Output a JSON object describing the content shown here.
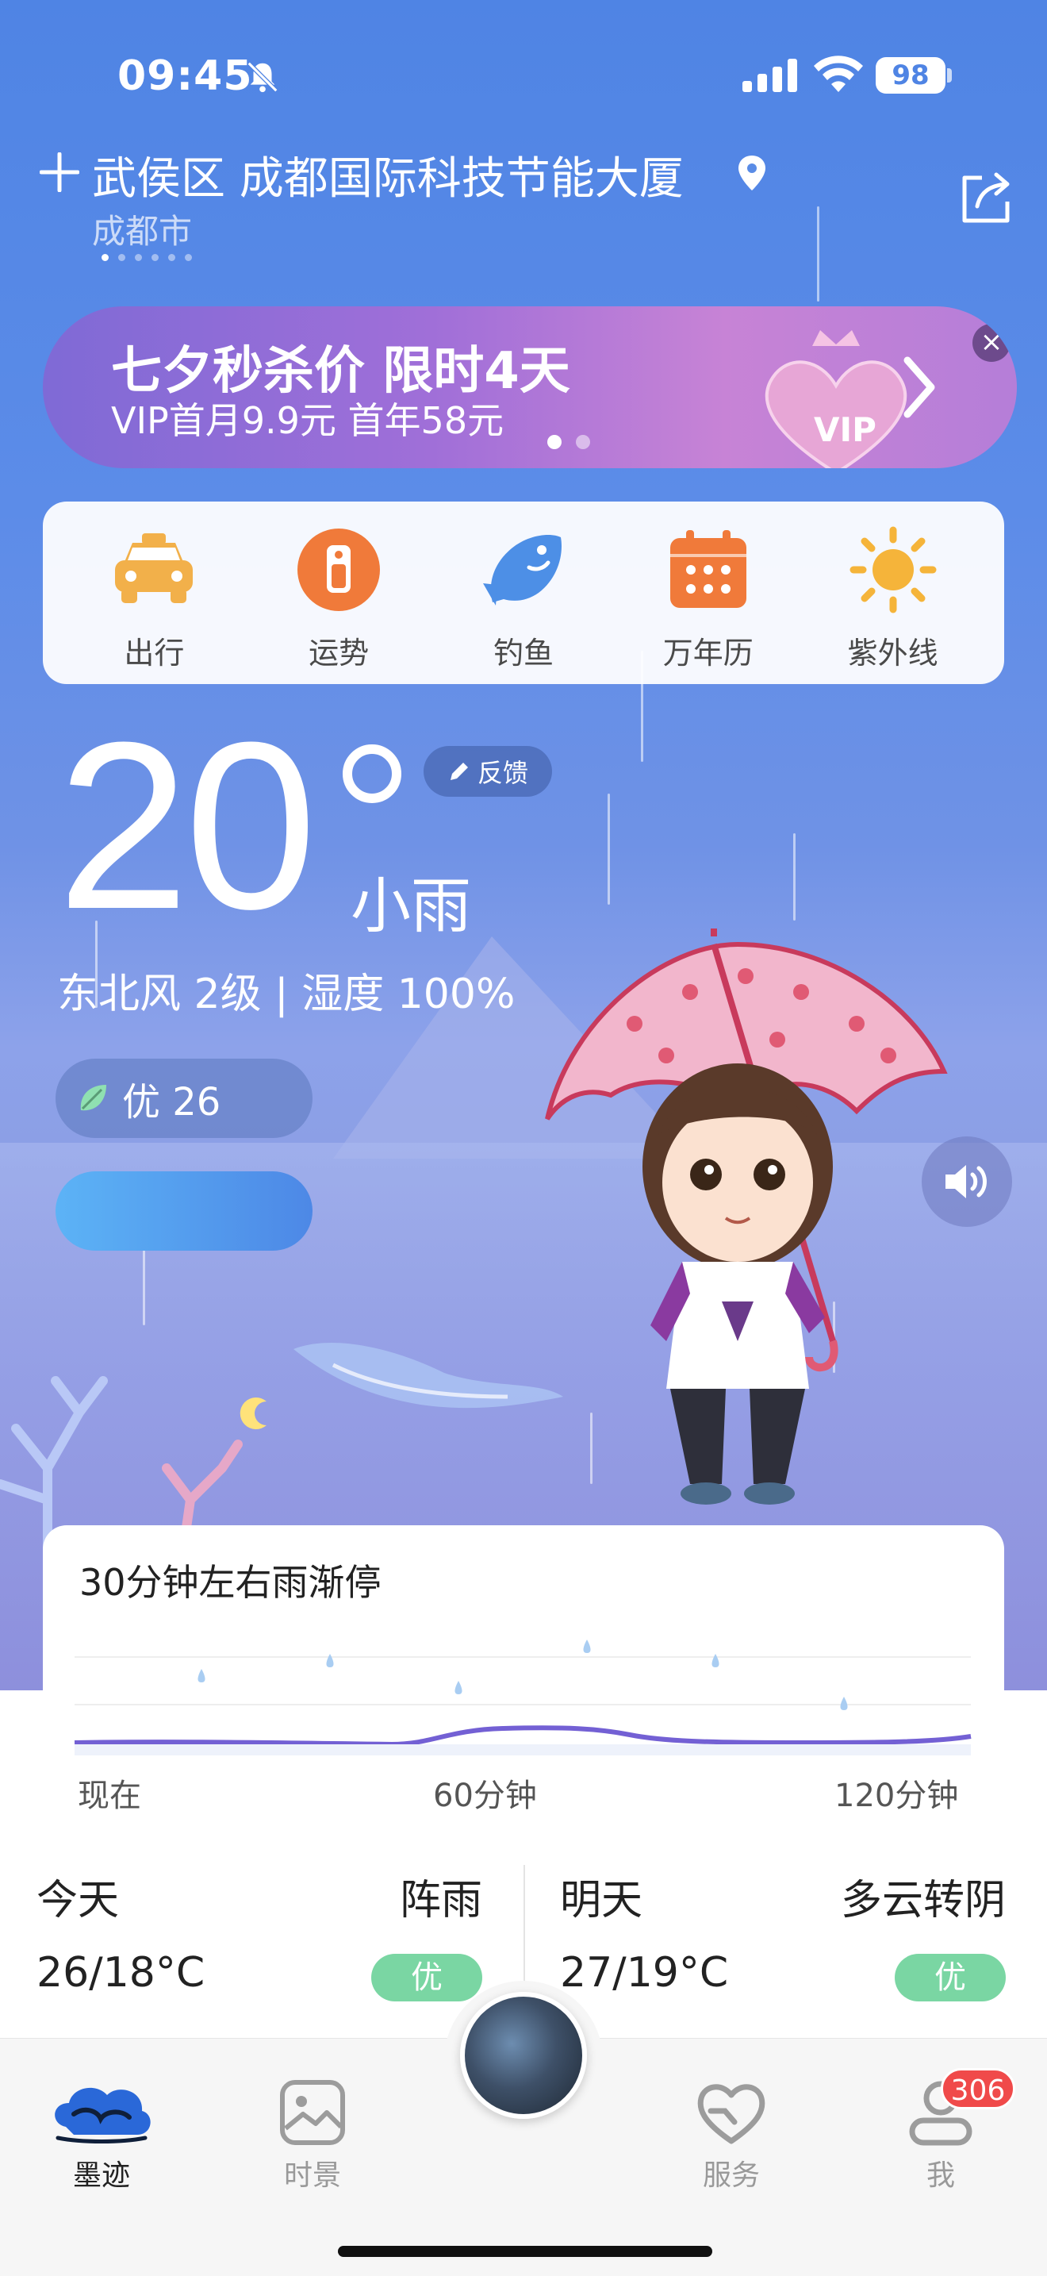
{
  "status_bar": {
    "time": "09:45",
    "battery": "98"
  },
  "location": {
    "title": "武侯区 成都国际科技节能大厦",
    "city": "成都市"
  },
  "banner": {
    "title": "七夕秒杀价 限时4天",
    "subtitle": "VIP首月9.9元 首年58元",
    "close": "×"
  },
  "tools": [
    {
      "label": "出行",
      "icon": "taxi-icon",
      "color": "#f2b04a"
    },
    {
      "label": "运势",
      "icon": "fortune-icon",
      "color": "#f07a3a"
    },
    {
      "label": "钓鱼",
      "icon": "fish-icon",
      "color": "#4d8fe6"
    },
    {
      "label": "万年历",
      "icon": "calendar-icon",
      "color": "#f07a3a"
    },
    {
      "label": "紫外线",
      "icon": "sun-icon",
      "color": "#f5b43a"
    }
  ],
  "current": {
    "temperature": "20",
    "condition": "小雨",
    "wind_humidity": "东北风 2级 | 湿度 100%",
    "aqi_label": "优 26",
    "feedback": "反馈"
  },
  "rain_forecast": {
    "title": "30分钟左右雨渐停",
    "axis": [
      "现在",
      "60分钟",
      "120分钟"
    ]
  },
  "days": [
    {
      "name": "今天",
      "condition": "阵雨",
      "temps": "26/18°C",
      "quality": "优"
    },
    {
      "name": "明天",
      "condition": "多云转阴",
      "temps": "27/19°C",
      "quality": "优"
    }
  ],
  "tabbar": {
    "items": [
      {
        "label": "墨迹",
        "icon": "moji-cloud-icon"
      },
      {
        "label": "时景",
        "icon": "photo-icon"
      },
      {
        "label": "服务",
        "icon": "heart-service-icon"
      },
      {
        "label": "我",
        "icon": "profile-icon"
      }
    ],
    "badge": "306"
  },
  "colors": {
    "sky_top": "#4f84e4",
    "accent_green": "#7ad6a3",
    "badge_red": "#f04a4a"
  }
}
